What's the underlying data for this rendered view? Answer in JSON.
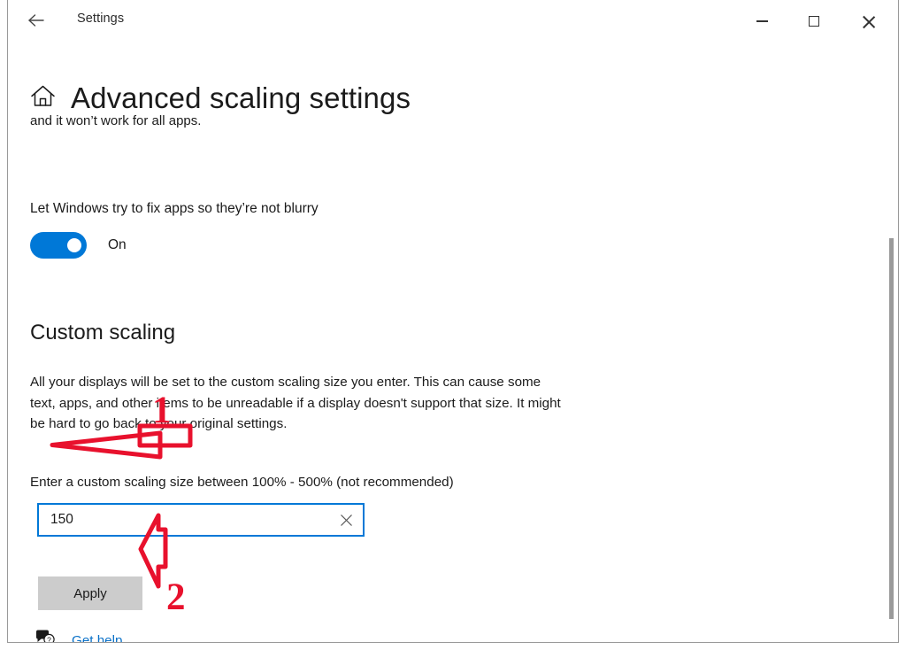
{
  "window": {
    "app_title": "Settings",
    "back_icon": "back-arrow-icon",
    "minimize_label": "Minimize",
    "maximize_label": "Maximize",
    "close_label": "Close"
  },
  "page": {
    "home_icon": "home-icon",
    "title": "Advanced scaling settings",
    "intro_text": "and it won’t work for all apps."
  },
  "fix_apps": {
    "label": "Let Windows try to fix apps so they’re not blurry",
    "toggle_state": "On",
    "toggle_on": true,
    "accent_color": "#0078d7"
  },
  "custom_scaling": {
    "heading": "Custom scaling",
    "description": "All your displays will be set to the custom scaling size you enter. This can cause some text, apps, and other items to be unreadable if a display doesn't support that size. It might be hard to go back to your original settings.",
    "input_label": "Enter a custom scaling size between 100% - 500% (not recommended)",
    "input_value": "150",
    "input_placeholder": "",
    "clear_icon": "close-x-icon",
    "apply_label": "Apply",
    "apply_bg_color": "#cccccc"
  },
  "help": {
    "icon": "speech-bubble-question-icon",
    "label": "Get help",
    "link_color": "#0a71c8"
  },
  "annotations": {
    "color": "#e8112d",
    "marker_1": "1",
    "marker_2": "2",
    "arrow_1": "down-arrow-annotation",
    "arrow_2": "left-arrow-annotation"
  },
  "scrollbar": {
    "thumb_color": "#9a9a9a"
  }
}
